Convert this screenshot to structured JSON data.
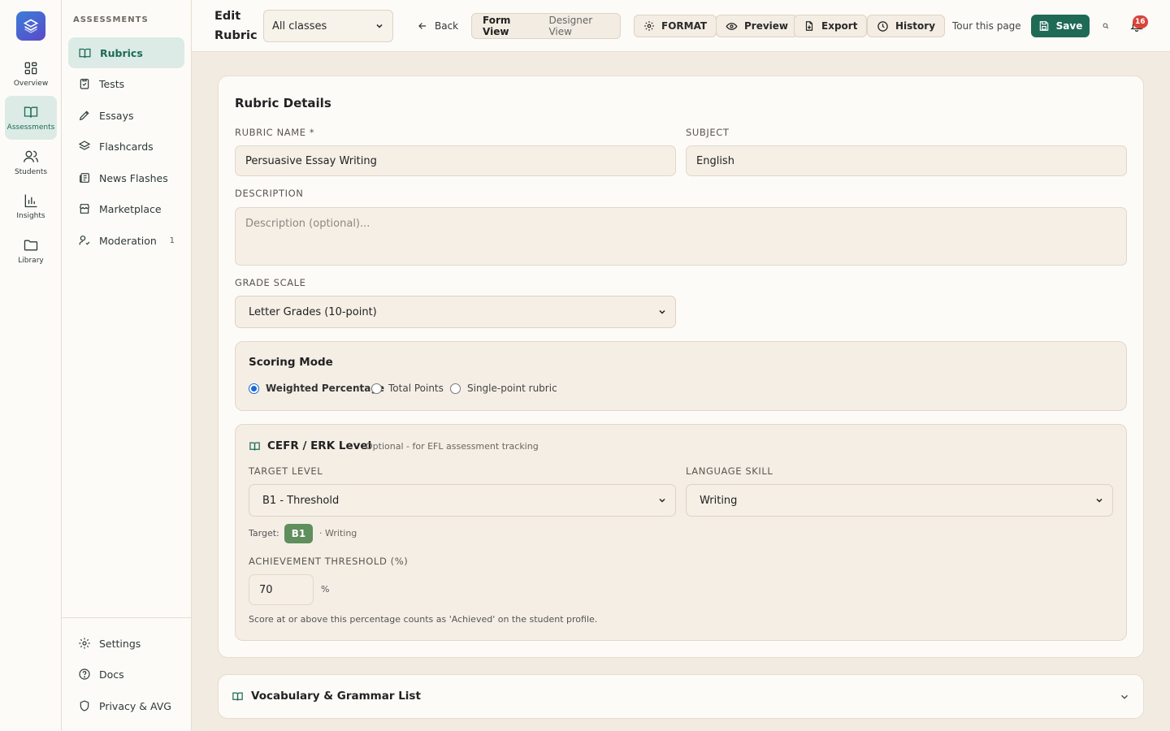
{
  "rail": {
    "items": [
      {
        "label": "Overview"
      },
      {
        "label": "Assessments"
      },
      {
        "label": "Students"
      },
      {
        "label": "Insights"
      },
      {
        "label": "Library"
      }
    ]
  },
  "sidebar": {
    "heading": "ASSESSMENTS",
    "items": [
      {
        "label": "Rubrics"
      },
      {
        "label": "Tests"
      },
      {
        "label": "Essays"
      },
      {
        "label": "Flashcards"
      },
      {
        "label": "News Flashes"
      },
      {
        "label": "Marketplace"
      },
      {
        "label": "Moderation",
        "count": "1"
      }
    ],
    "bottom": [
      {
        "label": "Settings"
      },
      {
        "label": "Docs"
      },
      {
        "label": "Privacy & AVG"
      }
    ]
  },
  "header": {
    "title": "Edit Rubric",
    "class_select": "All classes",
    "back": "Back",
    "view_form": "Form View",
    "view_designer": "Designer View",
    "format": "FORMAT",
    "preview": "Preview",
    "export": "Export",
    "history": "History",
    "tour": "Tour this page",
    "save": "Save",
    "notifications": "16"
  },
  "rubric": {
    "section_title": "Rubric Details",
    "name_label": "RUBRIC NAME *",
    "name_value": "Persuasive Essay Writing",
    "subject_label": "SUBJECT",
    "subject_value": "English",
    "description_label": "DESCRIPTION",
    "description_placeholder": "Description (optional)...",
    "grade_scale_label": "GRADE SCALE",
    "grade_scale_value": "Letter Grades (10-point)"
  },
  "scoring": {
    "title": "Scoring Mode",
    "options": [
      "Weighted Percentage",
      "Total Points",
      "Single-point rubric"
    ],
    "selected": "Weighted Percentage"
  },
  "cefr": {
    "title": "CEFR / ERK Level",
    "subtitle": "Optional - for EFL assessment tracking",
    "target_label": "TARGET LEVEL",
    "target_value": "B1 - Threshold",
    "skill_label": "LANGUAGE SKILL",
    "skill_value": "Writing",
    "target_prefix": "Target:",
    "target_tag": "B1",
    "target_skill": "· Writing",
    "threshold_label": "ACHIEVEMENT THRESHOLD (%)",
    "threshold_value": "70",
    "threshold_unit": "%",
    "threshold_help": "Score at or above this percentage counts as 'Achieved' on the student profile."
  },
  "vocab": {
    "title": "Vocabulary & Grammar List"
  },
  "colors": {
    "accent": "#1f6a55",
    "background": "#f1ebe1",
    "badge": "#d9443a",
    "cefr_tag": "#5e8f5d"
  }
}
